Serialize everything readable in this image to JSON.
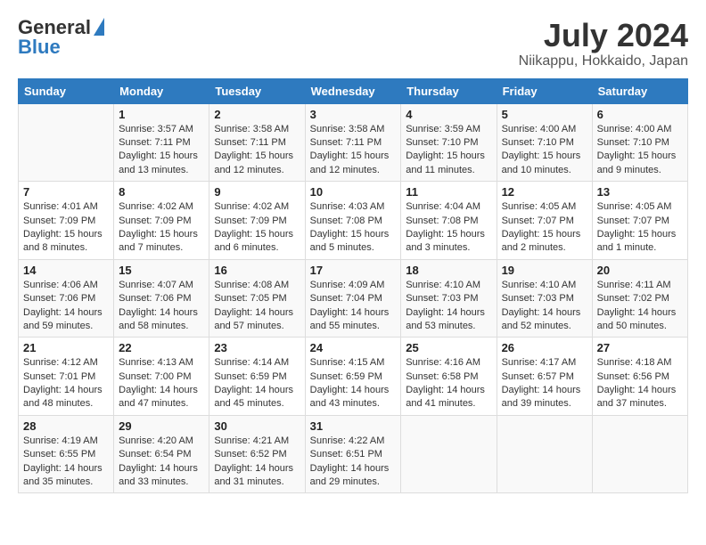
{
  "logo": {
    "general": "General",
    "blue": "Blue"
  },
  "title": "July 2024",
  "subtitle": "Niikappu, Hokkaido, Japan",
  "headers": [
    "Sunday",
    "Monday",
    "Tuesday",
    "Wednesday",
    "Thursday",
    "Friday",
    "Saturday"
  ],
  "weeks": [
    [
      {
        "day": "",
        "info": ""
      },
      {
        "day": "1",
        "info": "Sunrise: 3:57 AM\nSunset: 7:11 PM\nDaylight: 15 hours\nand 13 minutes."
      },
      {
        "day": "2",
        "info": "Sunrise: 3:58 AM\nSunset: 7:11 PM\nDaylight: 15 hours\nand 12 minutes."
      },
      {
        "day": "3",
        "info": "Sunrise: 3:58 AM\nSunset: 7:11 PM\nDaylight: 15 hours\nand 12 minutes."
      },
      {
        "day": "4",
        "info": "Sunrise: 3:59 AM\nSunset: 7:10 PM\nDaylight: 15 hours\nand 11 minutes."
      },
      {
        "day": "5",
        "info": "Sunrise: 4:00 AM\nSunset: 7:10 PM\nDaylight: 15 hours\nand 10 minutes."
      },
      {
        "day": "6",
        "info": "Sunrise: 4:00 AM\nSunset: 7:10 PM\nDaylight: 15 hours\nand 9 minutes."
      }
    ],
    [
      {
        "day": "7",
        "info": "Sunrise: 4:01 AM\nSunset: 7:09 PM\nDaylight: 15 hours\nand 8 minutes."
      },
      {
        "day": "8",
        "info": "Sunrise: 4:02 AM\nSunset: 7:09 PM\nDaylight: 15 hours\nand 7 minutes."
      },
      {
        "day": "9",
        "info": "Sunrise: 4:02 AM\nSunset: 7:09 PM\nDaylight: 15 hours\nand 6 minutes."
      },
      {
        "day": "10",
        "info": "Sunrise: 4:03 AM\nSunset: 7:08 PM\nDaylight: 15 hours\nand 5 minutes."
      },
      {
        "day": "11",
        "info": "Sunrise: 4:04 AM\nSunset: 7:08 PM\nDaylight: 15 hours\nand 3 minutes."
      },
      {
        "day": "12",
        "info": "Sunrise: 4:05 AM\nSunset: 7:07 PM\nDaylight: 15 hours\nand 2 minutes."
      },
      {
        "day": "13",
        "info": "Sunrise: 4:05 AM\nSunset: 7:07 PM\nDaylight: 15 hours\nand 1 minute."
      }
    ],
    [
      {
        "day": "14",
        "info": "Sunrise: 4:06 AM\nSunset: 7:06 PM\nDaylight: 14 hours\nand 59 minutes."
      },
      {
        "day": "15",
        "info": "Sunrise: 4:07 AM\nSunset: 7:06 PM\nDaylight: 14 hours\nand 58 minutes."
      },
      {
        "day": "16",
        "info": "Sunrise: 4:08 AM\nSunset: 7:05 PM\nDaylight: 14 hours\nand 57 minutes."
      },
      {
        "day": "17",
        "info": "Sunrise: 4:09 AM\nSunset: 7:04 PM\nDaylight: 14 hours\nand 55 minutes."
      },
      {
        "day": "18",
        "info": "Sunrise: 4:10 AM\nSunset: 7:03 PM\nDaylight: 14 hours\nand 53 minutes."
      },
      {
        "day": "19",
        "info": "Sunrise: 4:10 AM\nSunset: 7:03 PM\nDaylight: 14 hours\nand 52 minutes."
      },
      {
        "day": "20",
        "info": "Sunrise: 4:11 AM\nSunset: 7:02 PM\nDaylight: 14 hours\nand 50 minutes."
      }
    ],
    [
      {
        "day": "21",
        "info": "Sunrise: 4:12 AM\nSunset: 7:01 PM\nDaylight: 14 hours\nand 48 minutes."
      },
      {
        "day": "22",
        "info": "Sunrise: 4:13 AM\nSunset: 7:00 PM\nDaylight: 14 hours\nand 47 minutes."
      },
      {
        "day": "23",
        "info": "Sunrise: 4:14 AM\nSunset: 6:59 PM\nDaylight: 14 hours\nand 45 minutes."
      },
      {
        "day": "24",
        "info": "Sunrise: 4:15 AM\nSunset: 6:59 PM\nDaylight: 14 hours\nand 43 minutes."
      },
      {
        "day": "25",
        "info": "Sunrise: 4:16 AM\nSunset: 6:58 PM\nDaylight: 14 hours\nand 41 minutes."
      },
      {
        "day": "26",
        "info": "Sunrise: 4:17 AM\nSunset: 6:57 PM\nDaylight: 14 hours\nand 39 minutes."
      },
      {
        "day": "27",
        "info": "Sunrise: 4:18 AM\nSunset: 6:56 PM\nDaylight: 14 hours\nand 37 minutes."
      }
    ],
    [
      {
        "day": "28",
        "info": "Sunrise: 4:19 AM\nSunset: 6:55 PM\nDaylight: 14 hours\nand 35 minutes."
      },
      {
        "day": "29",
        "info": "Sunrise: 4:20 AM\nSunset: 6:54 PM\nDaylight: 14 hours\nand 33 minutes."
      },
      {
        "day": "30",
        "info": "Sunrise: 4:21 AM\nSunset: 6:52 PM\nDaylight: 14 hours\nand 31 minutes."
      },
      {
        "day": "31",
        "info": "Sunrise: 4:22 AM\nSunset: 6:51 PM\nDaylight: 14 hours\nand 29 minutes."
      },
      {
        "day": "",
        "info": ""
      },
      {
        "day": "",
        "info": ""
      },
      {
        "day": "",
        "info": ""
      }
    ]
  ]
}
